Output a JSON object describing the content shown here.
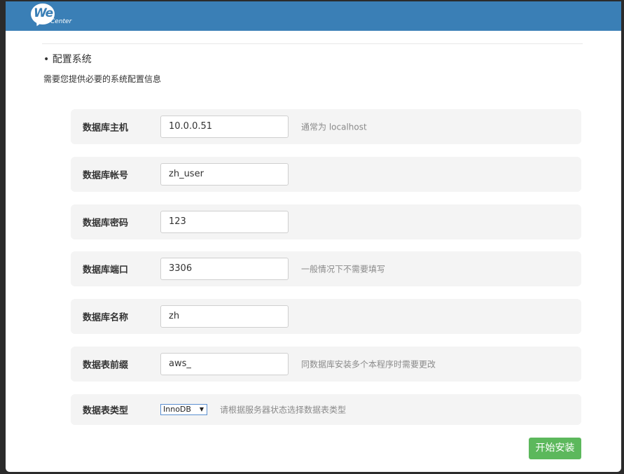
{
  "brand": {
    "logo_main": "We",
    "logo_sub": "Center"
  },
  "section": {
    "title": "• 配置系统",
    "description": "需要您提供必要的系统配置信息"
  },
  "fields": [
    {
      "label": "数据库主机",
      "value": "10.0.0.51",
      "hint": "通常为 localhost"
    },
    {
      "label": "数据库帐号",
      "value": "zh_user",
      "hint": ""
    },
    {
      "label": "数据库密码",
      "value": "123",
      "hint": ""
    },
    {
      "label": "数据库端口",
      "value": "3306",
      "hint": "一般情况下不需要填写"
    },
    {
      "label": "数据库名称",
      "value": "zh",
      "hint": ""
    },
    {
      "label": "数据表前缀",
      "value": "aws_",
      "hint": "同数据库安装多个本程序时需要更改"
    }
  ],
  "engine": {
    "label": "数据表类型",
    "selected": "InnoDB",
    "hint": "请根据服务器状态选择数据表类型"
  },
  "submit_label": "开始安装",
  "colors": {
    "header": "#3a7fb6",
    "submit": "#5cb85c",
    "row_bg": "#f4f4f4"
  }
}
